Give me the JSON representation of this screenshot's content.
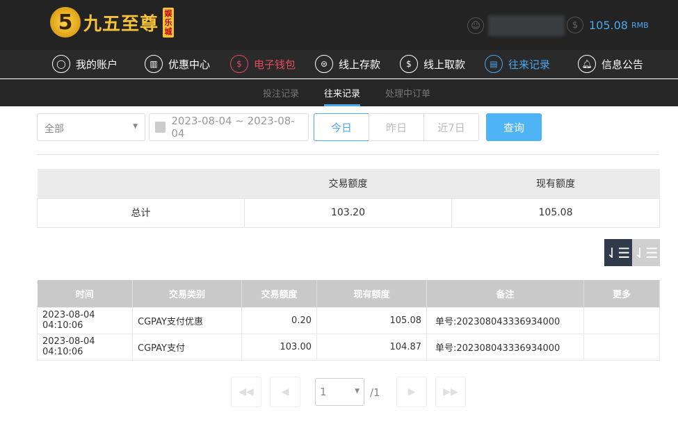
{
  "header": {
    "logo_text": "九五至尊",
    "logo_badge": "娱乐城",
    "logo_number": "5",
    "balance": "105.08",
    "currency": "RMB"
  },
  "nav": [
    {
      "label": "我的账户",
      "icon": "user-icon"
    },
    {
      "label": "优惠中心",
      "icon": "gift-icon"
    },
    {
      "label": "电子钱包",
      "icon": "wallet-icon"
    },
    {
      "label": "线上存款",
      "icon": "deposit-icon"
    },
    {
      "label": "线上取款",
      "icon": "withdraw-icon"
    },
    {
      "label": "往来记录",
      "icon": "records-icon"
    },
    {
      "label": "信息公告",
      "icon": "bell-icon"
    }
  ],
  "subnav": [
    "投注记录",
    "往来记录",
    "处理中订单"
  ],
  "filter": {
    "type": "全部",
    "date_range": "2023-08-04 ~ 2023-08-04",
    "quick": [
      "今日",
      "昨日",
      "近7日"
    ],
    "search": "查询"
  },
  "summary": {
    "headers": [
      "",
      "交易额度",
      "现有额度"
    ],
    "row": [
      "总计",
      "103.20",
      "105.08"
    ]
  },
  "table": {
    "headers": [
      "时间",
      "交易类别",
      "交易额度",
      "现有额度",
      "备注",
      "更多"
    ],
    "rows": [
      [
        "2023-08-04 04:10:06",
        "CGPAY支付优惠",
        "0.20",
        "105.08",
        "单号:202308043336934000",
        ""
      ],
      [
        "2023-08-04 04:10:06",
        "CGPAY支付",
        "103.00",
        "104.87",
        "单号:202308043336934000",
        ""
      ]
    ]
  },
  "pagination": {
    "page": "1",
    "total": "/1"
  },
  "colors": {
    "accent": "#4aa8ef",
    "active_red": "#e84a5f"
  }
}
